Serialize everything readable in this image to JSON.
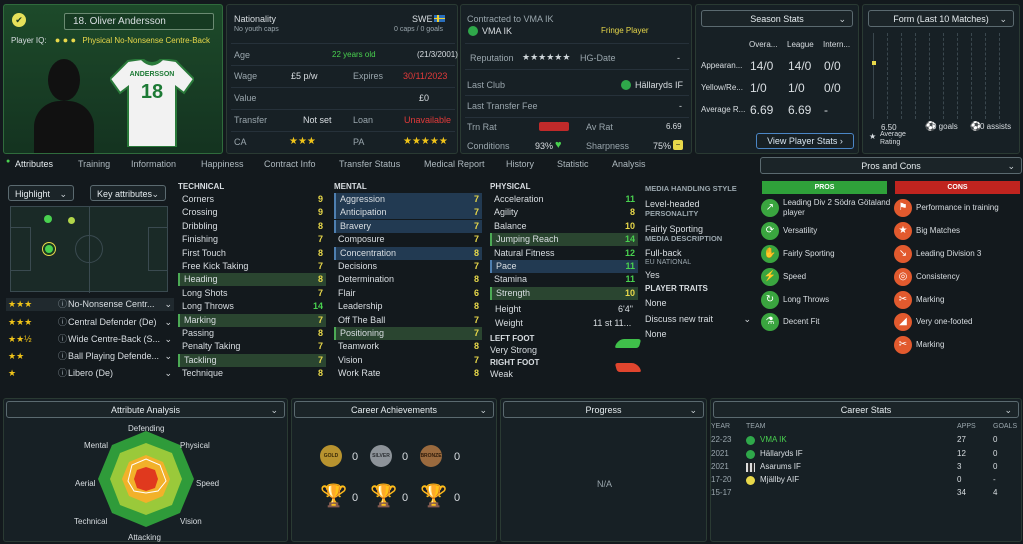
{
  "player": {
    "name": "18. Oliver Andersson",
    "iq_label": "Player IQ:",
    "iq_role": "Physical",
    "iq_desc": "No-Nonsense Centre-Back",
    "shirt_name": "ANDERSSON",
    "shirt_number": "18"
  },
  "info": {
    "nationality_label": "Nationality",
    "nationality": "SWE",
    "youth_caps": "No youth caps",
    "caps": "0 caps / 0 goals",
    "age_label": "Age",
    "age": "22 years old",
    "dob": "(21/3/2001)",
    "wage_label": "Wage",
    "wage": "£5 p/w",
    "expires_label": "Expires",
    "expires": "30/11/2023",
    "value_label": "Value",
    "value": "£0",
    "transfer_label": "Transfer",
    "transfer": "Not set",
    "loan_label": "Loan",
    "loan": "Unavailable",
    "ca_label": "CA",
    "pa_label": "PA",
    "ca_stars": "★★★",
    "pa_stars": "★★★★★"
  },
  "contract": {
    "title": "Contracted to VMA IK",
    "club": "VMA IK",
    "status": "Fringe Player",
    "reputation_label": "Reputation",
    "reputation_stars": "★★★★★★",
    "hg_label": "HG-Date",
    "hg_value": "-",
    "last_club_label": "Last Club",
    "last_club": "Hällaryds IF",
    "fee_label": "Last Transfer Fee",
    "fee": "-",
    "trn_rat_label": "Trn Rat",
    "av_rat_label": "Av Rat",
    "av_rat": "6.69",
    "conditions_label": "Conditions",
    "conditions": "93%",
    "sharpness_label": "Sharpness",
    "sharpness": "75%"
  },
  "season": {
    "title": "Season Stats",
    "cols": [
      "Overa...",
      "League",
      "Intern..."
    ],
    "rows": [
      {
        "label": "Appearan...",
        "vals": [
          "14/0",
          "14/0",
          "0/0"
        ]
      },
      {
        "label": "Yellow/Re...",
        "vals": [
          "1/0",
          "1/0",
          "0/0"
        ]
      },
      {
        "label": "Average R...",
        "vals": [
          "6.69",
          "6.69",
          "-"
        ]
      }
    ],
    "button": "View Player Stats ›"
  },
  "form": {
    "title": "Form (Last 10 Matches)",
    "avg": "6.50",
    "avg_label": "Average Rating",
    "goals": "0 goals",
    "assists": "0 assists"
  },
  "tabs": [
    "Attributes",
    "Training",
    "Information",
    "Happiness",
    "Contract Info",
    "Transfer Status",
    "Medical Report",
    "History",
    "Statistic",
    "Analysis"
  ],
  "left": {
    "highlight": "Highlight",
    "key_attrs": "Key attributes",
    "roles": [
      {
        "stars": "★★★",
        "name": "No-Nonsense Centr..."
      },
      {
        "stars": "★★★",
        "name": "Central Defender (De)"
      },
      {
        "stars": "★★½",
        "name": "Wide Centre-Back (S..."
      },
      {
        "stars": "★★",
        "name": "Ball Playing Defende..."
      },
      {
        "stars": "★",
        "name": "Libero (De)"
      }
    ]
  },
  "technical": {
    "title": "TECHNICAL",
    "items": [
      {
        "n": "Corners",
        "v": "9"
      },
      {
        "n": "Crossing",
        "v": "9"
      },
      {
        "n": "Dribbling",
        "v": "8"
      },
      {
        "n": "Finishing",
        "v": "7"
      },
      {
        "n": "First Touch",
        "v": "8"
      },
      {
        "n": "Free Kick Taking",
        "v": "7"
      },
      {
        "n": "Heading",
        "v": "8"
      },
      {
        "n": "Long Shots",
        "v": "7"
      },
      {
        "n": "Long Throws",
        "v": "14"
      },
      {
        "n": "Marking",
        "v": "7"
      },
      {
        "n": "Passing",
        "v": "8"
      },
      {
        "n": "Penalty Taking",
        "v": "7"
      },
      {
        "n": "Tackling",
        "v": "7"
      },
      {
        "n": "Technique",
        "v": "8"
      }
    ]
  },
  "mental": {
    "title": "MENTAL",
    "items": [
      {
        "n": "Aggression",
        "v": "7"
      },
      {
        "n": "Anticipation",
        "v": "7"
      },
      {
        "n": "Bravery",
        "v": "7"
      },
      {
        "n": "Composure",
        "v": "7"
      },
      {
        "n": "Concentration",
        "v": "8"
      },
      {
        "n": "Decisions",
        "v": "7"
      },
      {
        "n": "Determination",
        "v": "8"
      },
      {
        "n": "Flair",
        "v": "6"
      },
      {
        "n": "Leadership",
        "v": "8"
      },
      {
        "n": "Off The Ball",
        "v": "7"
      },
      {
        "n": "Positioning",
        "v": "7"
      },
      {
        "n": "Teamwork",
        "v": "8"
      },
      {
        "n": "Vision",
        "v": "7"
      },
      {
        "n": "Work Rate",
        "v": "8"
      }
    ]
  },
  "physical": {
    "title": "PHYSICAL",
    "items": [
      {
        "n": "Acceleration",
        "v": "11"
      },
      {
        "n": "Agility",
        "v": "8"
      },
      {
        "n": "Balance",
        "v": "10"
      },
      {
        "n": "Jumping Reach",
        "v": "14"
      },
      {
        "n": "Natural Fitness",
        "v": "12"
      },
      {
        "n": "Pace",
        "v": "11"
      },
      {
        "n": "Stamina",
        "v": "11"
      },
      {
        "n": "Strength",
        "v": "10"
      }
    ],
    "height_label": "Height",
    "height": "6'4\"",
    "weight_label": "Weight",
    "weight": "11 st 11...",
    "left_foot_label": "LEFT FOOT",
    "left_foot": "Very Strong",
    "right_foot_label": "RIGHT FOOT",
    "right_foot": "Weak"
  },
  "media": {
    "style_label": "MEDIA HANDLING STYLE",
    "style": "Level-headed",
    "personality_label": "PERSONALITY",
    "personality": "Fairly Sporting",
    "desc_label": "MEDIA DESCRIPTION",
    "desc": "Full-back",
    "eu_label": "EU NATIONAL",
    "eu": "Yes",
    "traits_label": "PLAYER TRAITS",
    "traits": "None",
    "discuss": "Discuss new trait",
    "traits2": "None"
  },
  "proscons": {
    "title": "Pros and Cons",
    "pros_label": "PROS",
    "cons_label": "CONS",
    "pros": [
      "Leading Div 2 Södra Götaland player",
      "Versatility",
      "Fairly Sporting",
      "Speed",
      "Long Throws",
      "Decent Fit"
    ],
    "cons": [
      "Performance in training",
      "Big Matches",
      "Leading Division 3",
      "Consistency",
      "Marking",
      "Very one-footed",
      "Marking"
    ]
  },
  "analysis": {
    "title": "Attribute Analysis",
    "labels": [
      "Defending",
      "Physical",
      "Speed",
      "Vision",
      "Attacking",
      "Technical",
      "Aerial",
      "Mental"
    ]
  },
  "achievements": {
    "title": "Career Achievements",
    "gold": "0",
    "silver": "0",
    "bronze": "0",
    "cup1": "0",
    "cup2": "0",
    "cup3": "0",
    "gold_text": "GOLD",
    "silver_text": "SILVER",
    "bronze_text": "BRONZE"
  },
  "progress": {
    "title": "Progress",
    "na": "N/A"
  },
  "career": {
    "title": "Career Stats",
    "cols": [
      "YEAR",
      "TEAM",
      "APPS",
      "GOALS"
    ],
    "rows": [
      {
        "year": "22-23",
        "team": "VMA IK",
        "apps": "27",
        "goals": "0"
      },
      {
        "year": "2021",
        "team": "Hällaryds IF",
        "apps": "12",
        "goals": "0"
      },
      {
        "year": "2021",
        "team": "Asarums IF",
        "apps": "3",
        "goals": "0"
      },
      {
        "year": "17-20",
        "team": "Mjällby AIF",
        "apps": "0",
        "goals": "-"
      },
      {
        "year": "15-17",
        "team": "",
        "apps": "34",
        "goals": "4"
      }
    ]
  }
}
